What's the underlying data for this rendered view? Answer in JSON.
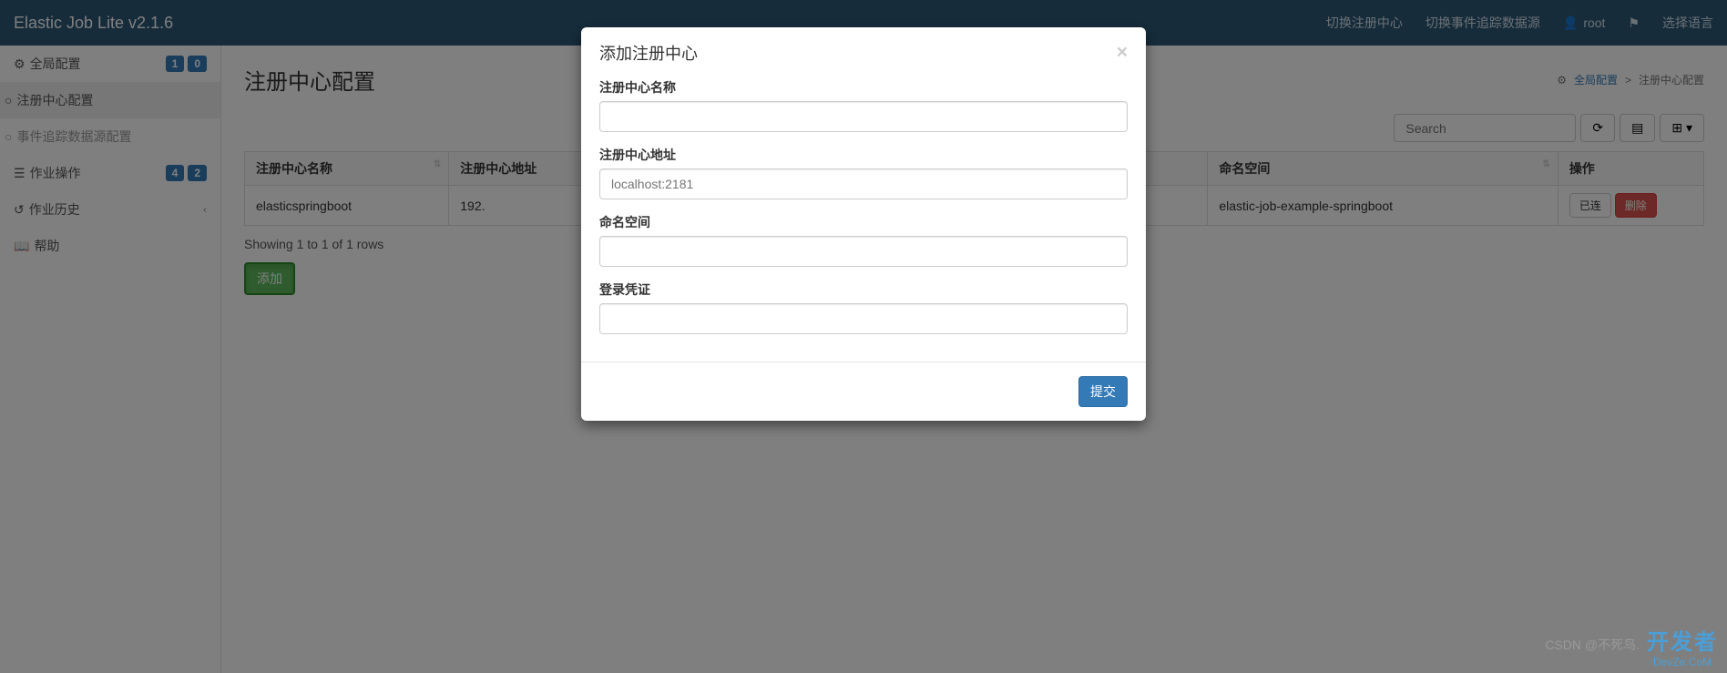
{
  "navbar": {
    "brand": "Elastic Job Lite v2.1.6",
    "switch_reg": "切换注册中心",
    "switch_event": "切换事件追踪数据源",
    "user": "root",
    "lang": "选择语言"
  },
  "sidebar": {
    "global_config": {
      "label": "全局配置",
      "badge1": "1",
      "badge2": "0"
    },
    "reg_center": "注册中心配置",
    "event_trace": "事件追踪数据源配置",
    "job_ops": {
      "label": "作业操作",
      "badge1": "4",
      "badge2": "2"
    },
    "job_history": "作业历史",
    "help": "帮助"
  },
  "content": {
    "title": "注册中心配置",
    "breadcrumb": {
      "link": "全局配置",
      "current": "注册中心配置"
    },
    "search_placeholder": "Search",
    "pagination": "Showing 1 to 1 of 1 rows",
    "add_button": "添加"
  },
  "table": {
    "headers": {
      "name": "注册中心名称",
      "address": "注册中心地址",
      "namespace": "命名空间",
      "ops": "操作"
    },
    "row": {
      "name": "elasticspringboot",
      "address": "192.",
      "namespace": "elastic-job-example-springboot",
      "connected": "已连",
      "delete": "删除"
    }
  },
  "modal": {
    "title": "添加注册中心",
    "name_label": "注册中心名称",
    "address_label": "注册中心地址",
    "address_placeholder": "localhost:2181",
    "namespace_label": "命名空间",
    "credentials_label": "登录凭证",
    "submit": "提交"
  },
  "watermark": {
    "csdn": "CSDN @不死鸟.",
    "brand": "开发者",
    "sub": "DevZe.CoM"
  }
}
